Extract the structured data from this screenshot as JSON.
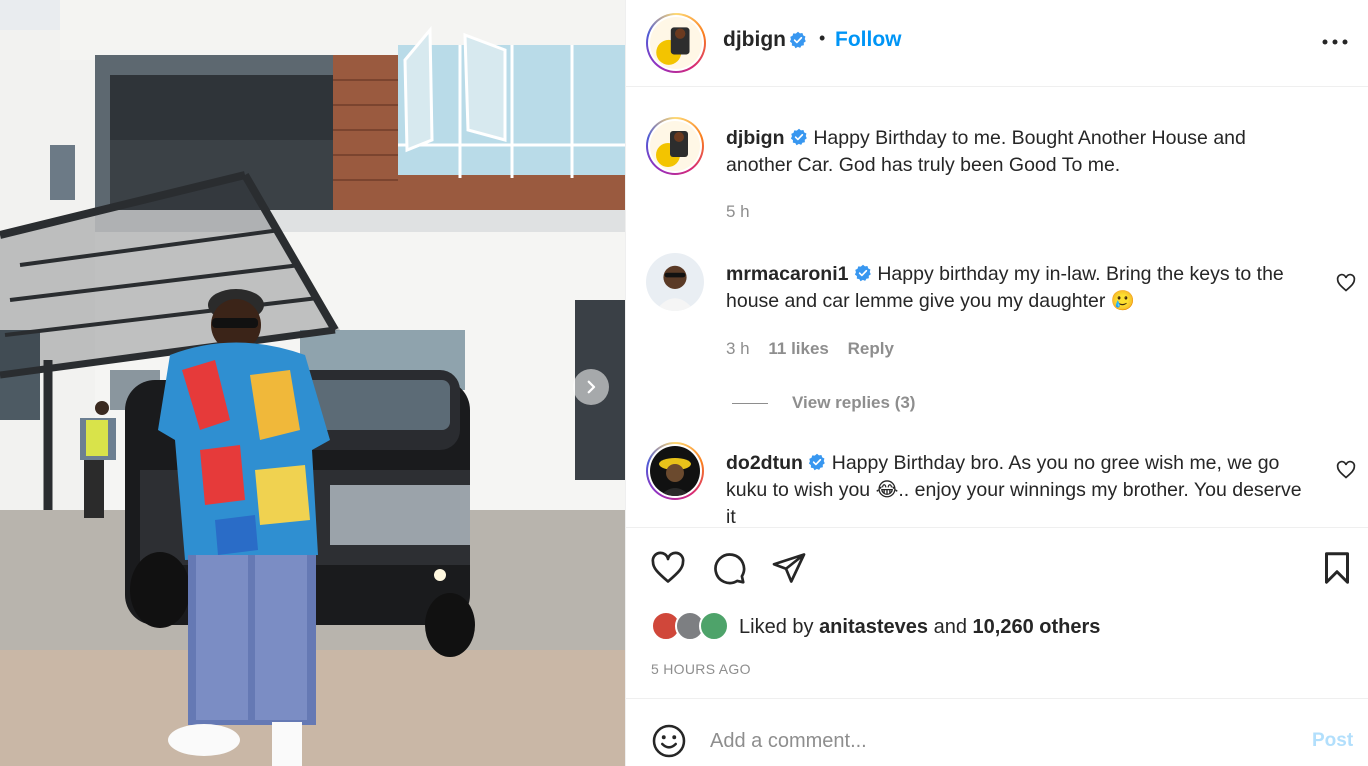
{
  "post": {
    "author": "djbign",
    "follow_label": "Follow",
    "separator": "•",
    "caption": "Happy Birthday to me. Bought Another House and another Car. God has truly been Good To me.",
    "caption_time": "5 h",
    "view_replies": "View replies (3)",
    "liked_prefix": "Liked by",
    "liked_user": "anitasteves",
    "liked_and": "and",
    "liked_others": "10,260 others",
    "time_ago": "5 HOURS AGO"
  },
  "comments": [
    {
      "username": "mrmacaroni1",
      "text": "Happy birthday my in-law. Bring the keys to the house and car lemme give you my daughter",
      "emoji": "🥲",
      "time": "3 h",
      "likes": "11 likes",
      "reply_label": "Reply"
    },
    {
      "username": "do2dtun",
      "text_a": "Happy Birthday bro. As you no gree wish me, we go kuku to wish you",
      "emoji": "😂",
      "text_b": ".. enjoy your winnings my brother. You deserve it"
    }
  ],
  "comment_box": {
    "placeholder": "Add a comment...",
    "post_label": "Post"
  },
  "colors": {
    "link_blue": "#0095f6",
    "verified_blue": "#3897f0",
    "muted": "#8e8e8e",
    "post_disabled": "#b2dffc"
  },
  "icons": [
    "chevron-right-icon",
    "verified-icon",
    "more-icon",
    "heart-icon",
    "comment-icon",
    "share-icon",
    "bookmark-icon",
    "emoji-icon"
  ]
}
